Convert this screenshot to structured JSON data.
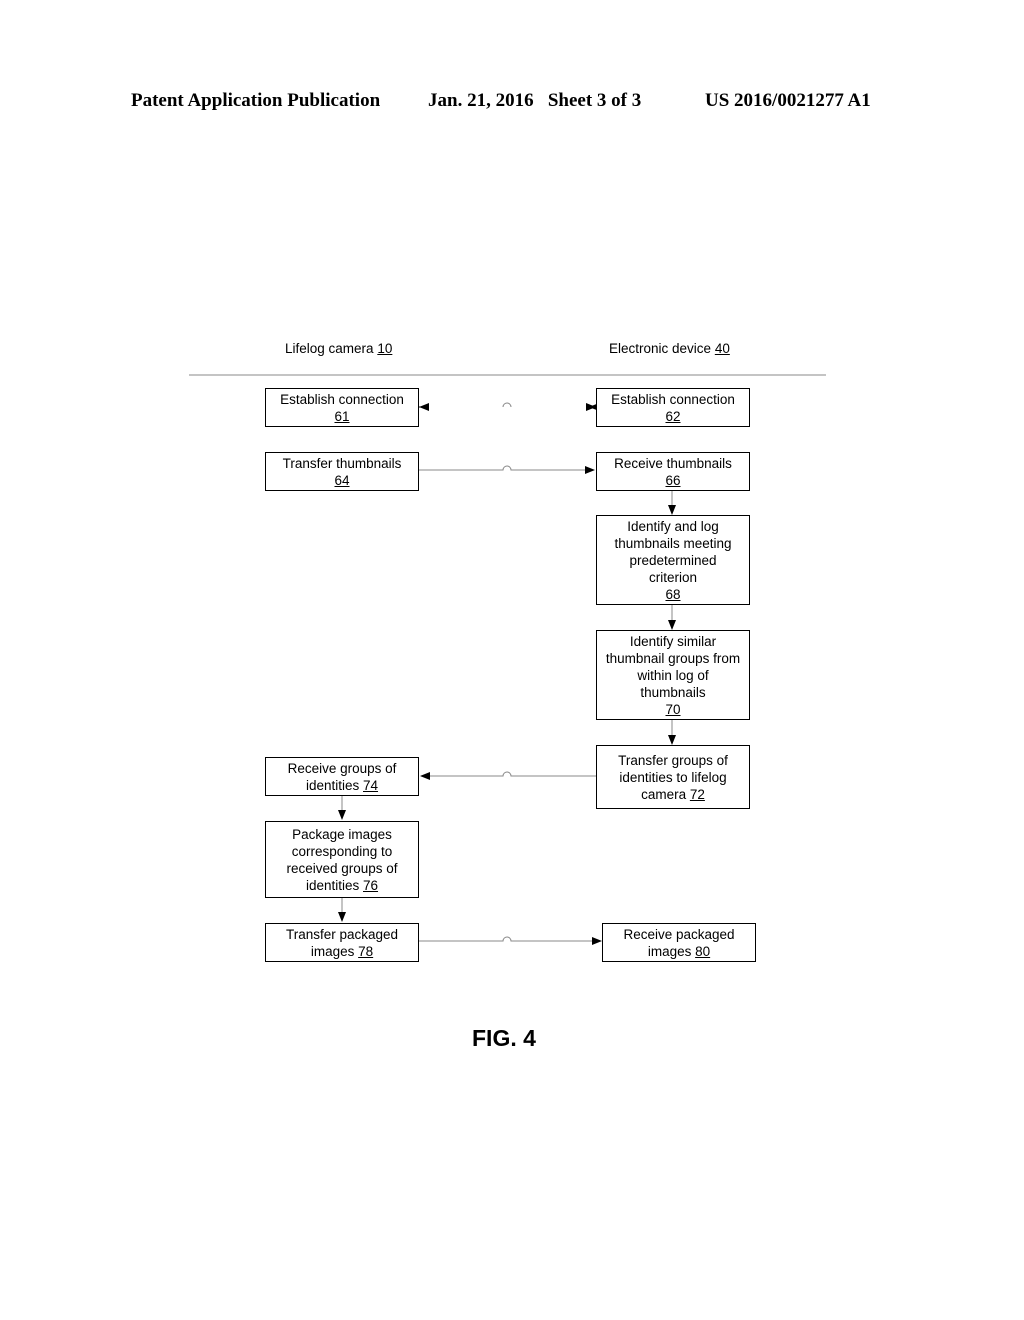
{
  "header": {
    "publication": "Patent Application Publication",
    "date_sheet": "Jan. 21, 2016   Sheet 3 of 3",
    "patent_number": "US 2016/0021277 A1"
  },
  "lanes": {
    "left": {
      "label": "Lifelog camera ",
      "ref": "10"
    },
    "right": {
      "label": "Electronic device ",
      "ref": "40"
    }
  },
  "boxes": {
    "b61": {
      "text": "Establish connection",
      "ref": "61"
    },
    "b62": {
      "text": "Establish connection",
      "ref": "62"
    },
    "b64": {
      "text": "Transfer thumbnails",
      "ref": "64"
    },
    "b66": {
      "text": "Receive thumbnails",
      "ref": "66"
    },
    "b68": {
      "text": "Identify and log\nthumbnails meeting\npredetermined\ncriterion",
      "ref": "68"
    },
    "b70": {
      "text": "Identify similar\nthumbnail groups from\nwithin log of\nthumbnails",
      "ref": "70"
    },
    "b72": {
      "text": "Transfer groups of\nidentities to lifelog\ncamera ",
      "ref": "72"
    },
    "b74": {
      "text": "Receive groups of\nidentities ",
      "ref": "74"
    },
    "b76": {
      "text": "Package images\ncorresponding to\nreceived groups of\nidentities ",
      "ref": "76"
    },
    "b78": {
      "text": "Transfer packaged\nimages ",
      "ref": "78"
    },
    "b80": {
      "text": "Receive packaged\nimages ",
      "ref": "80"
    }
  },
  "figure_label": "FIG. 4"
}
